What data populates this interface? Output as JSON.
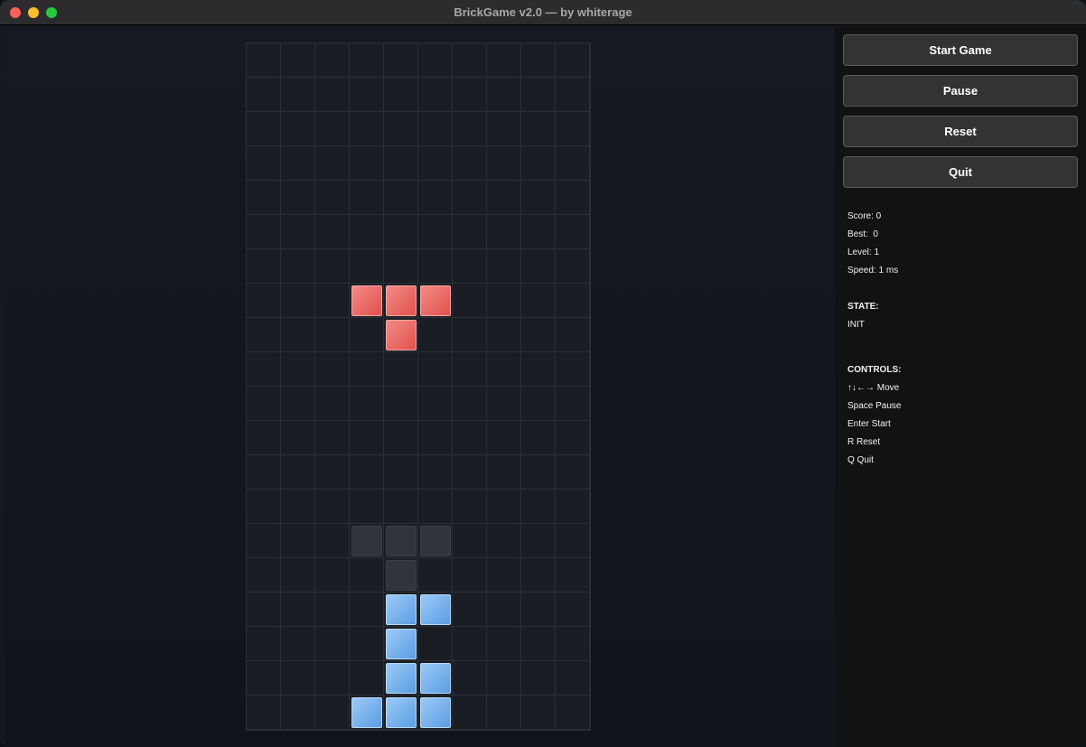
{
  "window": {
    "title": "BrickGame v2.0 — by whiterage"
  },
  "board": {
    "cols": 10,
    "rows": 20,
    "red_cells": [
      [
        3,
        7
      ],
      [
        4,
        7
      ],
      [
        5,
        7
      ],
      [
        4,
        8
      ]
    ],
    "ghost_cells": [
      [
        3,
        14
      ],
      [
        4,
        14
      ],
      [
        5,
        14
      ],
      [
        4,
        15
      ]
    ],
    "blue_cells": [
      [
        4,
        16
      ],
      [
        5,
        16
      ],
      [
        4,
        17
      ],
      [
        4,
        18
      ],
      [
        5,
        18
      ],
      [
        3,
        19
      ],
      [
        4,
        19
      ],
      [
        5,
        19
      ]
    ],
    "colors": {
      "active_piece": "#e66b67",
      "ghost_piece": "#30343b",
      "locked_blocks": "#6aa8e8"
    }
  },
  "buttons": {
    "start": "Start Game",
    "pause": "Pause",
    "reset": "Reset",
    "quit": "Quit"
  },
  "stats": {
    "score": "Score: 0",
    "best": "Best:  0",
    "level": "Level: 1",
    "speed": "Speed: 1 ms"
  },
  "state": {
    "heading": "STATE:",
    "value": "INIT"
  },
  "controls": {
    "heading": "CONTROLS:",
    "items": [
      "↑↓←→ Move",
      "Space Pause",
      "Enter Start",
      "R Reset",
      "Q Quit"
    ]
  }
}
